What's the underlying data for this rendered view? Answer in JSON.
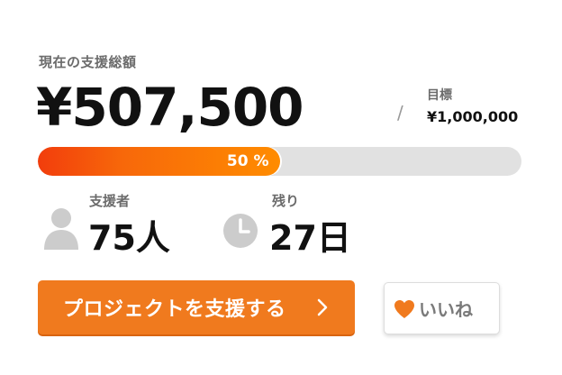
{
  "funding": {
    "current_label": "現在の支援総額",
    "current_amount": "¥507,500",
    "separator": "/",
    "goal_label": "目標",
    "goal_amount": "¥1,000,000"
  },
  "progress": {
    "percent": 50,
    "percent_label": "50 %"
  },
  "stats": {
    "supporters_label": "支援者",
    "supporters_value": "75人",
    "remaining_label": "残り",
    "remaining_value": "27日"
  },
  "actions": {
    "support_label": "プロジェクトを支援する",
    "like_label": "いいね"
  },
  "icons": {
    "supporters": "user-icon",
    "remaining": "clock-icon",
    "support_chevron": "chevron-right-icon",
    "like": "heart-icon"
  },
  "colors": {
    "accent": "#f07a1e",
    "progress_start": "#f23d0c",
    "progress_end": "#ff8c00",
    "track": "#e1e1e1",
    "heart": "#f07a1e",
    "icon_gray": "#cccccc"
  }
}
